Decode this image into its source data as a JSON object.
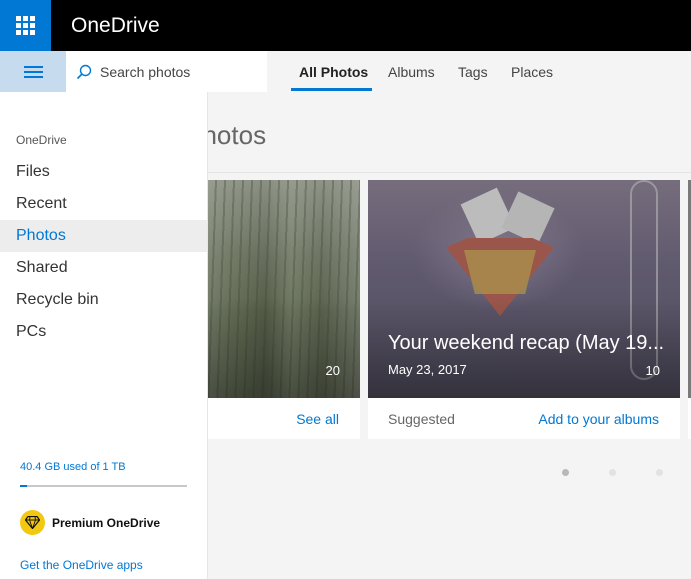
{
  "topbar": {
    "brand": "OneDrive"
  },
  "search": {
    "placeholder": "Search photos"
  },
  "tabs": [
    {
      "label": "All Photos",
      "active": true
    },
    {
      "label": "Albums"
    },
    {
      "label": "Tags"
    },
    {
      "label": "Places"
    }
  ],
  "main": {
    "title_partial": "photos",
    "cards": [
      {
        "count": "20",
        "footer_link": "See all"
      },
      {
        "title": "Your weekend recap (May 19...",
        "date": "May 23, 2017",
        "count": "10",
        "footer_label": "Suggested",
        "footer_link": "Add to your albums"
      }
    ],
    "pagination": {
      "pages": 3,
      "active": 0
    }
  },
  "sidebar": {
    "heading": "OneDrive",
    "items": [
      {
        "label": "Files"
      },
      {
        "label": "Recent"
      },
      {
        "label": "Photos",
        "active": true
      },
      {
        "label": "Shared"
      },
      {
        "label": "Recycle bin"
      },
      {
        "label": "PCs"
      }
    ],
    "storage": {
      "text": "40.4 GB used of 1 TB",
      "used_fraction": 0.04
    },
    "premium_label": "Premium OneDrive",
    "get_apps": "Get the OneDrive apps"
  },
  "colors": {
    "accent": "#0078d4",
    "topbar": "#000000",
    "premium_gem": "#f2c811"
  }
}
